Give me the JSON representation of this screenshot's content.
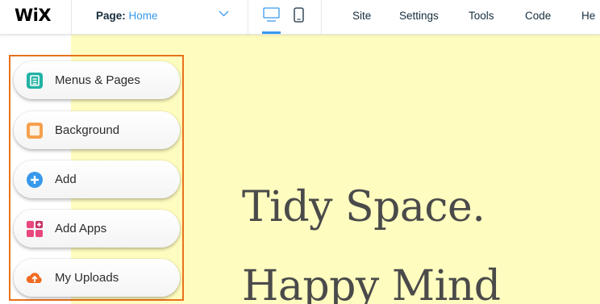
{
  "app": {
    "logo": "WiX"
  },
  "topbar": {
    "page_label": "Page:",
    "page_value": "Home",
    "menu": [
      "Site",
      "Settings",
      "Tools",
      "Code",
      "He"
    ]
  },
  "panel": {
    "items": [
      {
        "label": "Menus & Pages",
        "icon": "menus-pages-icon",
        "color": "#22b2a4"
      },
      {
        "label": "Background",
        "icon": "background-icon",
        "color": "#f6a04d"
      },
      {
        "label": "Add",
        "icon": "add-icon",
        "color": "#3899ec"
      },
      {
        "label": "Add Apps",
        "icon": "add-apps-icon",
        "color": "#e8487f"
      },
      {
        "label": "My Uploads",
        "icon": "my-uploads-icon",
        "color": "#f06b22"
      }
    ],
    "highlight_color": "#e8721c"
  },
  "canvas": {
    "headline_1": "Tidy Space.",
    "headline_2": "Happy Mind",
    "background": "#fffcbf"
  },
  "colors": {
    "accent": "#3899ec",
    "text_dark": "#162d3d"
  }
}
